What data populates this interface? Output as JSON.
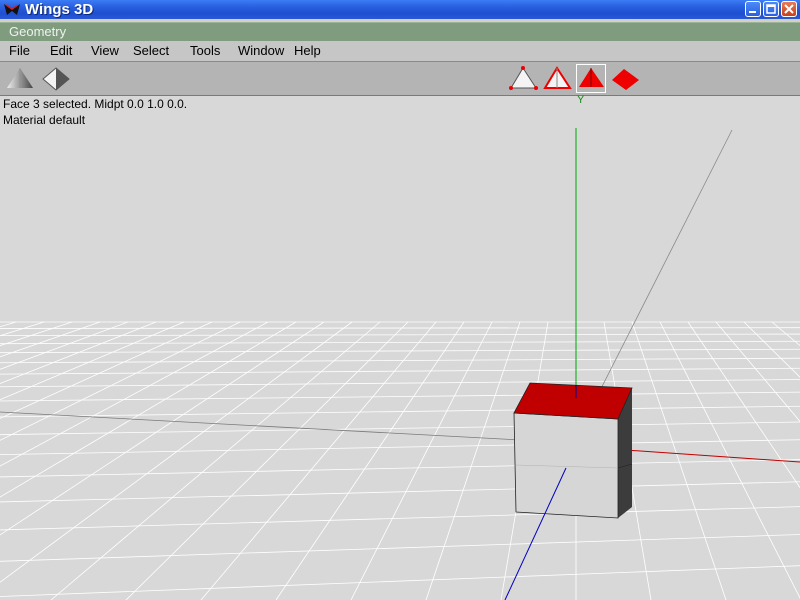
{
  "window": {
    "title": "Wings 3D"
  },
  "geometry_window": {
    "title": "Geometry"
  },
  "menu": [
    "File",
    "Edit",
    "View",
    "Select",
    "Tools",
    "Window",
    "Help"
  ],
  "toolbar": {
    "left_buttons": [
      {
        "name": "smooth-shaded-icon"
      },
      {
        "name": "wireframe-icon"
      }
    ],
    "select_modes": [
      {
        "name": "vertex-select-mode-icon",
        "selected": false
      },
      {
        "name": "edge-select-mode-icon",
        "selected": false
      },
      {
        "name": "face-select-mode-icon",
        "selected": true
      },
      {
        "name": "object-select-mode-icon",
        "selected": false
      }
    ]
  },
  "status": {
    "line1": "Face 3 selected. Midpt 0.0 1.0 0.0.",
    "line2": "Material default"
  },
  "viewport": {
    "y_axis_label": "Y",
    "colors": {
      "x_axis": "#c00000",
      "y_axis": "#00aa00",
      "z_axis": "#0000c0",
      "selected_face": "#c00000"
    }
  }
}
